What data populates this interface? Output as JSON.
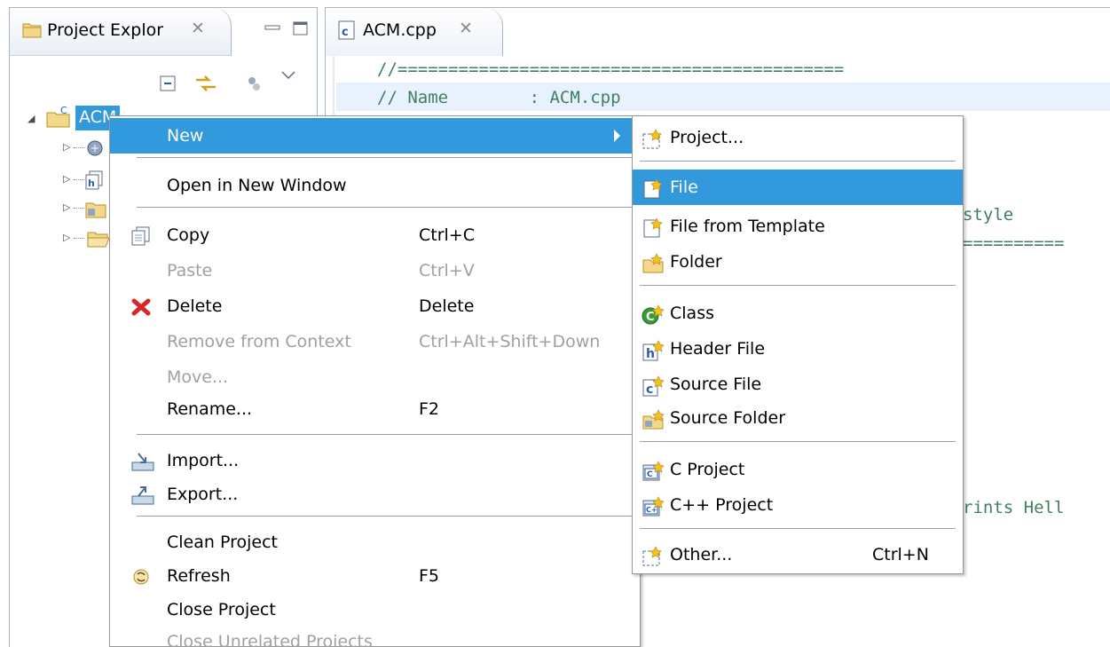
{
  "explorer": {
    "tab_title": "Project Explor",
    "tab_close": "✕"
  },
  "tree": {
    "project_name": "ACM"
  },
  "editor": {
    "tab_title": "ACM.cpp",
    "tab_close": "✕",
    "code_lines": [
      "//============================================",
      "// Name        : ACM.cpp",
      "style",
      "==========",
      "rints Hell"
    ]
  },
  "context_menu": {
    "items": [
      {
        "label": "New",
        "shortcut": ""
      },
      {
        "label": "Open in New Window",
        "shortcut": ""
      },
      {
        "label": "Copy",
        "shortcut": "Ctrl+C"
      },
      {
        "label": "Paste",
        "shortcut": "Ctrl+V"
      },
      {
        "label": "Delete",
        "shortcut": "Delete"
      },
      {
        "label": "Remove from Context",
        "shortcut": "Ctrl+Alt+Shift+Down"
      },
      {
        "label": "Move...",
        "shortcut": ""
      },
      {
        "label": "Rename...",
        "shortcut": "F2"
      },
      {
        "label": "Import...",
        "shortcut": ""
      },
      {
        "label": "Export...",
        "shortcut": ""
      },
      {
        "label": "Clean Project",
        "shortcut": ""
      },
      {
        "label": "Refresh",
        "shortcut": "F5"
      },
      {
        "label": "Close Project",
        "shortcut": ""
      },
      {
        "label": "Close Unrelated Projects",
        "shortcut": ""
      }
    ]
  },
  "submenu": {
    "items": [
      {
        "label": "Project...",
        "shortcut": ""
      },
      {
        "label": "File",
        "shortcut": ""
      },
      {
        "label": "File from Template",
        "shortcut": ""
      },
      {
        "label": "Folder",
        "shortcut": ""
      },
      {
        "label": "Class",
        "shortcut": ""
      },
      {
        "label": "Header File",
        "shortcut": ""
      },
      {
        "label": "Source File",
        "shortcut": ""
      },
      {
        "label": "Source Folder",
        "shortcut": ""
      },
      {
        "label": "C Project",
        "shortcut": ""
      },
      {
        "label": "C++ Project",
        "shortcut": ""
      },
      {
        "label": "Other...",
        "shortcut": "Ctrl+N"
      }
    ]
  },
  "colors": {
    "selection": "#3399dd",
    "comment": "#3f7f5f",
    "disabled": "#a0a0a0"
  }
}
